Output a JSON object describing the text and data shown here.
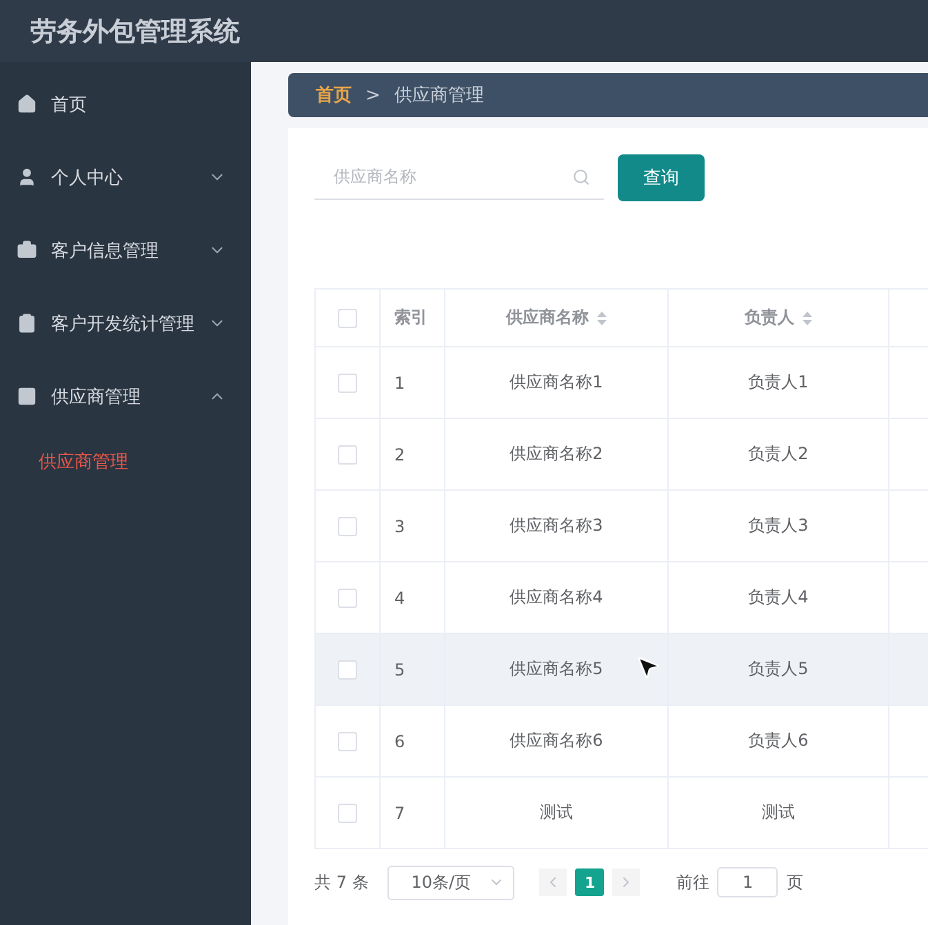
{
  "app_title": "劳务外包管理系统",
  "sidebar": {
    "items": [
      {
        "label": "首页",
        "kind": "link"
      },
      {
        "label": "个人中心",
        "kind": "menu",
        "expanded": false
      },
      {
        "label": "客户信息管理",
        "kind": "menu",
        "expanded": false
      },
      {
        "label": "客户开发统计管理",
        "kind": "menu",
        "expanded": false
      },
      {
        "label": "供应商管理",
        "kind": "menu",
        "expanded": true,
        "children": [
          {
            "label": "供应商管理",
            "selected": true
          }
        ]
      }
    ]
  },
  "breadcrumb": [
    {
      "label": "首页",
      "current": false
    },
    {
      "label": "供应商管理",
      "current": true
    }
  ],
  "breadcrumb_separator": ">",
  "search": {
    "placeholder": "供应商名称",
    "button": "查询"
  },
  "table": {
    "select_all_checked": false,
    "columns": [
      {
        "label": "索引",
        "sortable": false
      },
      {
        "label": "供应商名称",
        "sortable": true
      },
      {
        "label": "负责人",
        "sortable": true
      }
    ],
    "rows": [
      {
        "checked": false,
        "hovered": false,
        "cells": [
          "1",
          "供应商名称1",
          "负责人1"
        ]
      },
      {
        "checked": false,
        "hovered": false,
        "cells": [
          "2",
          "供应商名称2",
          "负责人2"
        ]
      },
      {
        "checked": false,
        "hovered": false,
        "cells": [
          "3",
          "供应商名称3",
          "负责人3"
        ]
      },
      {
        "checked": false,
        "hovered": false,
        "cells": [
          "4",
          "供应商名称4",
          "负责人4"
        ]
      },
      {
        "checked": false,
        "hovered": true,
        "cells": [
          "5",
          "供应商名称5",
          "负责人5"
        ]
      },
      {
        "checked": false,
        "hovered": false,
        "cells": [
          "6",
          "供应商名称6",
          "负责人6"
        ]
      },
      {
        "checked": false,
        "hovered": false,
        "cells": [
          "7",
          "测试",
          "测试"
        ]
      }
    ]
  },
  "pagination": {
    "total": "共 7 条",
    "page_size": "10条/页",
    "pages": [
      {
        "label": "1",
        "selected": true
      }
    ],
    "goto_label": "前往",
    "goto_value": "1",
    "page_suffix": "页"
  }
}
